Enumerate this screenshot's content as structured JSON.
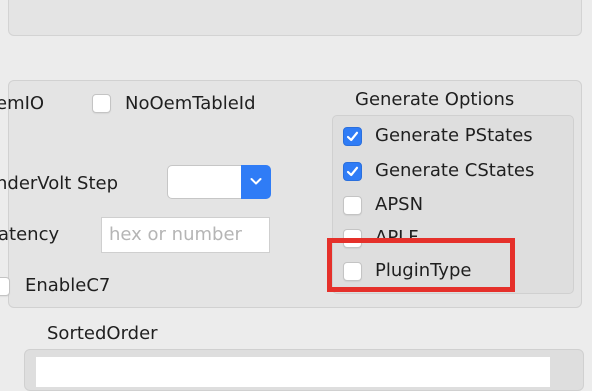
{
  "left_options": {
    "oem_io_partial": "emIO",
    "no_oem_table_id": "NoOemTableId",
    "undervolt_step_partial": "nderVolt Step",
    "latency_partial": "atency",
    "latency_placeholder": "hex or number",
    "enable_c7": "EnableC7"
  },
  "generate_options": {
    "title": "Generate Options",
    "items": [
      {
        "label": "Generate PStates",
        "checked": true
      },
      {
        "label": "Generate CStates",
        "checked": true
      },
      {
        "label": "APSN",
        "checked": false
      },
      {
        "label": "APLF",
        "checked": false
      },
      {
        "label": "PluginType",
        "checked": false
      }
    ]
  },
  "sorted_order": {
    "title": "SortedOrder"
  },
  "colors": {
    "accent": "#2f7cf6",
    "highlight": "#e5302a"
  }
}
